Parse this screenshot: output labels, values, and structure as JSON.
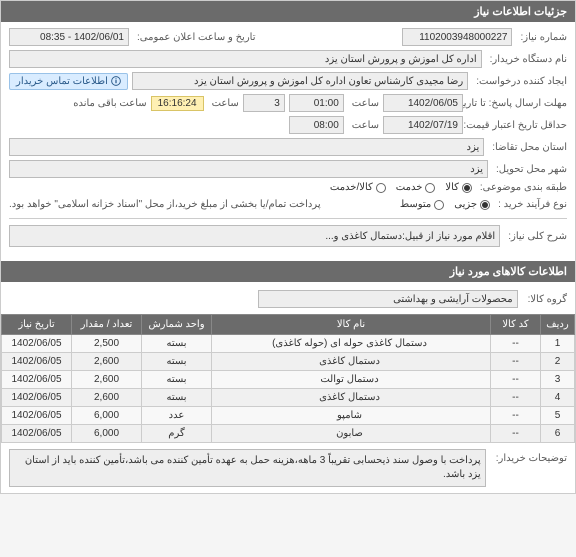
{
  "panel_title": "جزئیات اطلاعات نیاز",
  "need_number_label": "شماره نیاز:",
  "need_number": "1102003948000227",
  "public_datetime_label": "تاریخ و ساعت اعلان عمومی:",
  "public_datetime": "1402/06/01 - 08:35",
  "buyer_org_label": "نام دستگاه خریدار:",
  "buyer_org": "اداره کل اموزش و پرورش استان یزد",
  "requester_label": "ایجاد کننده درخواست:",
  "requester": "رضا مجیدی کارشناس تعاون اداره کل اموزش و پرورش استان یزد",
  "contact_chip": "اطلاعات تماس خریدار",
  "deadline_label": "مهلت ارسال پاسخ: تا تاریخ:",
  "deadline_date": "1402/06/05",
  "time_word": "ساعت",
  "deadline_time": "01:00",
  "days_count": "3",
  "remaining_label": "ساعت باقی مانده",
  "remaining_time": "16:16:24",
  "validity_label": "حداقل تاریخ اعتبار قیمت: تا تاریخ:",
  "validity_date": "1402/07/19",
  "validity_time": "08:00",
  "province_req_label": "استان محل تقاضا:",
  "province": "یزد",
  "city_deliv_label": "شهر محل تحویل:",
  "city": "یزد",
  "category_label": "طبقه بندی موضوعی:",
  "cat_goods": "کالا",
  "cat_service": "خدمت",
  "cat_goods_service": "کالا/خدمت",
  "purchase_type_label": "نوع فرآیند خرید :",
  "pt_small": "جزیی",
  "pt_medium": "متوسط",
  "payment_note": "پرداخت تمام/یا بخشی از مبلغ خرید،از محل \"اسناد خزانه اسلامی\" خواهد بود.",
  "general_desc_label": "شرح کلی نیاز:",
  "general_desc": "اقلام مورد نیاز از قبیل:دستمال کاغذی و...",
  "items_section_title": "اطلاعات کالاهای مورد نیاز",
  "goods_group_label": "گروه کالا:",
  "goods_group": "محصولات آرایشی و بهداشتی",
  "columns": {
    "row": "ردیف",
    "code": "کد کالا",
    "name": "نام کالا",
    "unit": "واحد شمارش",
    "qty": "تعداد / مقدار",
    "date": "تاریخ نیاز"
  },
  "items": [
    {
      "row": "1",
      "code": "--",
      "name": "دستمال کاغذی حوله ای (حوله کاغذی)",
      "unit": "بسته",
      "qty": "2,500",
      "date": "1402/06/05"
    },
    {
      "row": "2",
      "code": "--",
      "name": "دستمال کاغذی",
      "unit": "بسته",
      "qty": "2,600",
      "date": "1402/06/05"
    },
    {
      "row": "3",
      "code": "--",
      "name": "دستمال توالت",
      "unit": "بسته",
      "qty": "2,600",
      "date": "1402/06/05"
    },
    {
      "row": "4",
      "code": "--",
      "name": "دستمال کاغذی",
      "unit": "بسته",
      "qty": "2,600",
      "date": "1402/06/05"
    },
    {
      "row": "5",
      "code": "--",
      "name": "شامپو",
      "unit": "عدد",
      "qty": "6,000",
      "date": "1402/06/05"
    },
    {
      "row": "6",
      "code": "--",
      "name": "صابون",
      "unit": "گرم",
      "qty": "6,000",
      "date": "1402/06/05"
    }
  ],
  "buyer_notes_label": "توضیحات خریدار:",
  "buyer_notes": "پرداخت با وصول سند ذیحسابی تقریباً 3 ماهه،هزینه حمل به عهده تأمین کننده می باشد،تأمین کننده باید از استان یزد باشد."
}
